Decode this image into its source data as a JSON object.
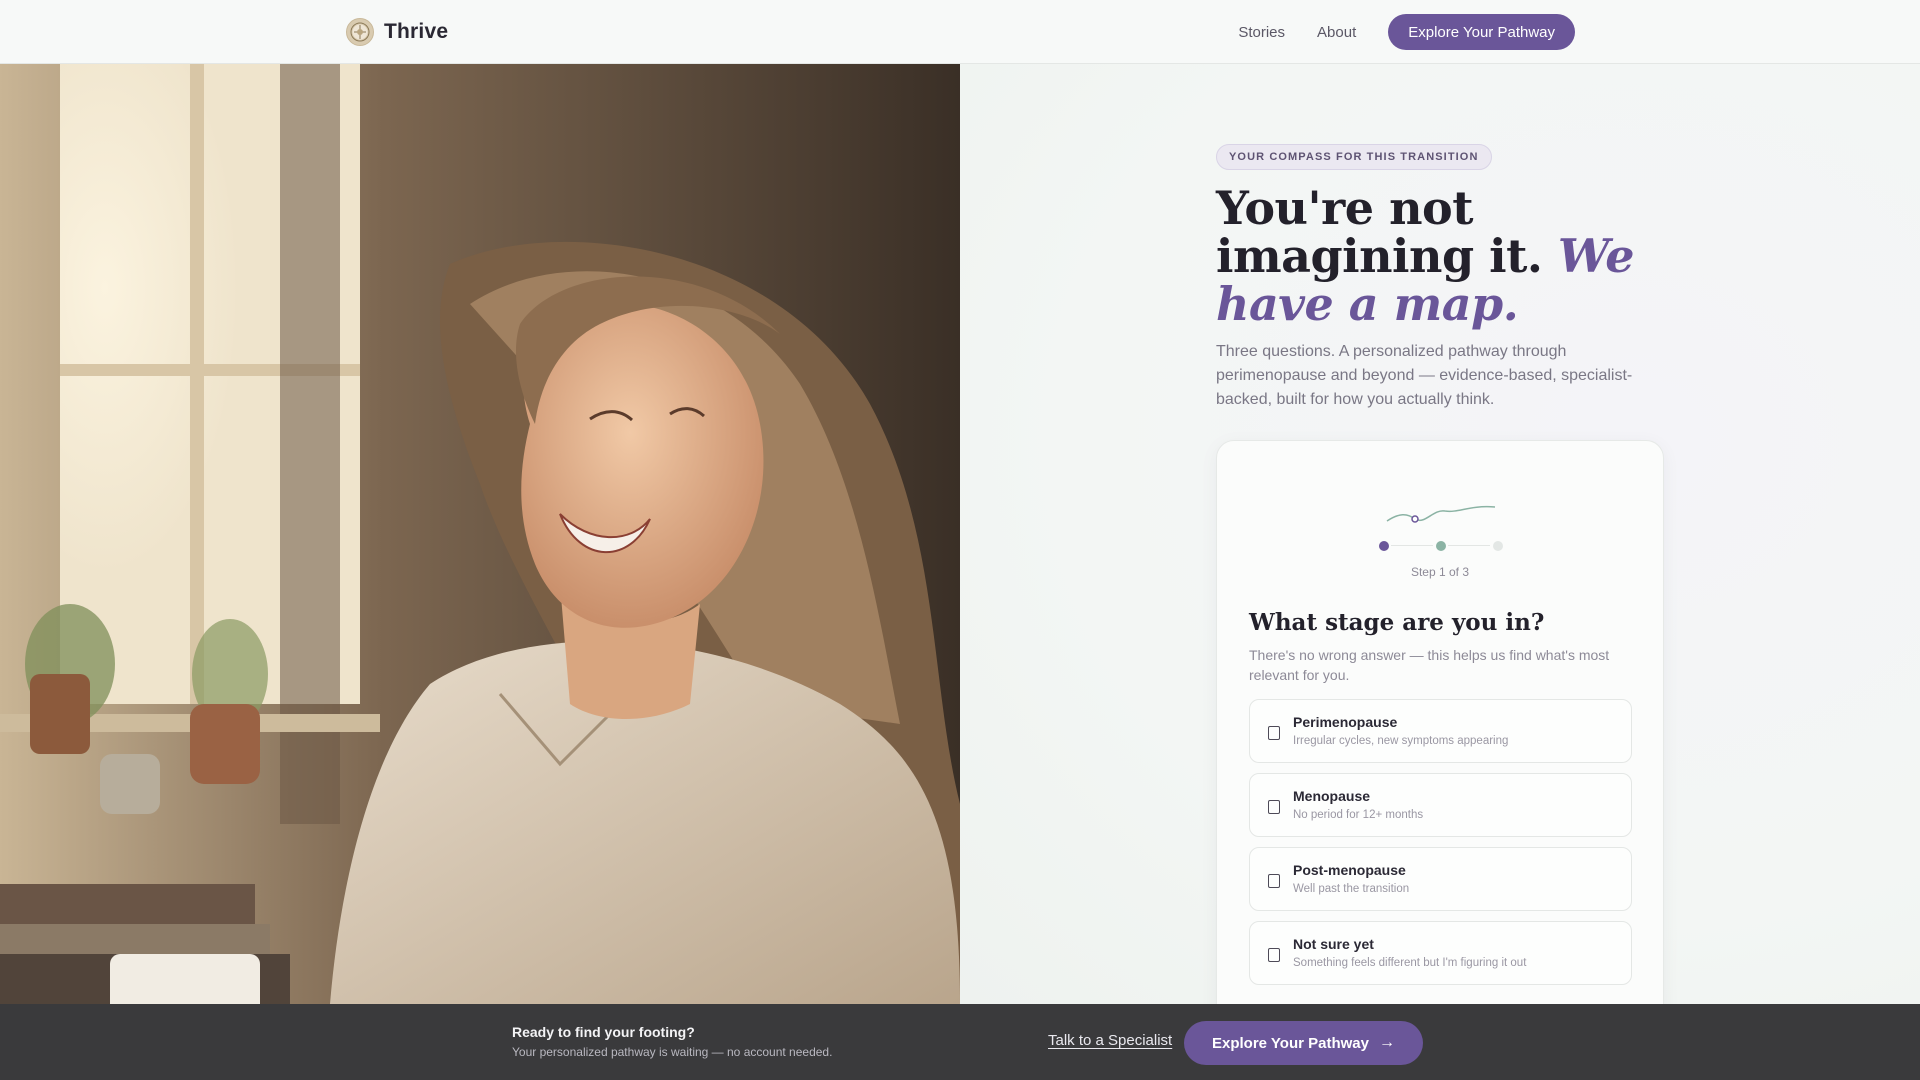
{
  "brand": {
    "name": "Thrive"
  },
  "nav": {
    "links": [
      "Stories",
      "About"
    ],
    "cta": "Explore Your Pathway"
  },
  "hero": {
    "eyebrow": "YOUR COMPASS FOR THIS TRANSITION",
    "headline_plain": "You're not imagining it.",
    "headline_accent": "We have a map.",
    "lede": "Three questions. A personalized pathway through perimenopause and beyond — evidence-based, specialist-backed, built for how you actually think."
  },
  "quiz": {
    "step_label": "Step 1 of 3",
    "current_step": 1,
    "total_steps": 3,
    "question": "What stage are you in?",
    "subtitle": "There's no wrong answer — this helps us find what's most relevant for you.",
    "options": [
      {
        "label": "Perimenopause",
        "desc": "Irregular cycles, new symptoms appearing"
      },
      {
        "label": "Menopause",
        "desc": "No period for 12+ months"
      },
      {
        "label": "Post-menopause",
        "desc": "Well past the transition"
      },
      {
        "label": "Not sure yet",
        "desc": "Something feels different but I'm figuring it out"
      }
    ]
  },
  "bottom_bar": {
    "title": "Ready to find your footing?",
    "subtitle": "Your personalized pathway is waiting — no account needed.",
    "link": "Talk to a Specialist",
    "cta": "Explore Your Pathway",
    "cta_icon": "arrow-right-icon"
  },
  "colors": {
    "accent": "#6a5699",
    "secondary": "#8bb3a4",
    "bar_bg": "#3a3a3c"
  }
}
